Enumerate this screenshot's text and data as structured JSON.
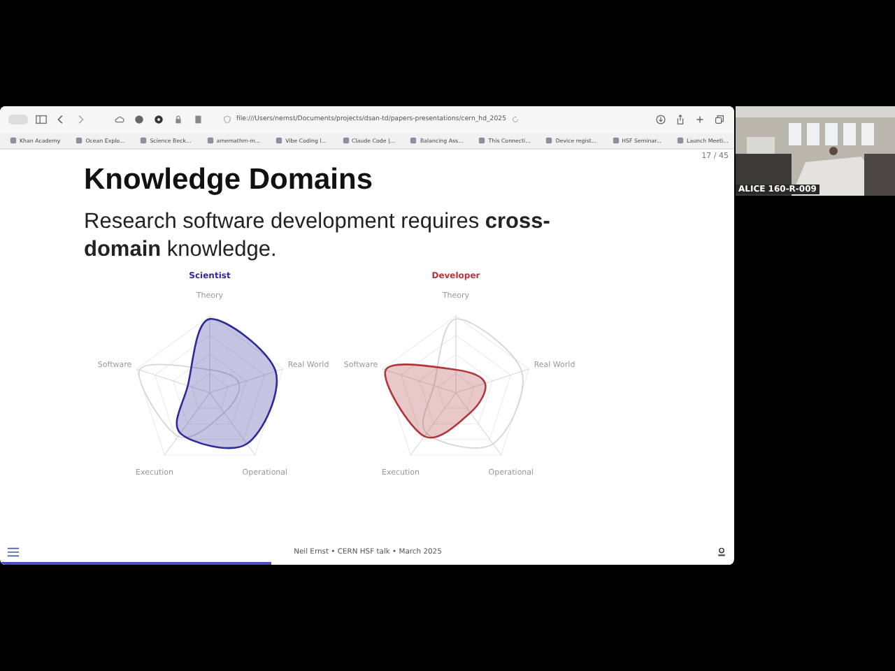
{
  "browser": {
    "url": "file:///Users/nernst/Documents/projects/dsan-td/papers-presentations/cern_hd_2025",
    "bookmarks": [
      {
        "label": "Khan Academy"
      },
      {
        "label": "Ocean Explo..."
      },
      {
        "label": "Science Beck..."
      },
      {
        "label": "amemathm-m..."
      },
      {
        "label": "Vibe Coding l..."
      },
      {
        "label": "Claude Code |..."
      },
      {
        "label": "Balancing Ass..."
      },
      {
        "label": "This Connecti..."
      },
      {
        "label": "Device regist..."
      },
      {
        "label": "HSF Seminar..."
      },
      {
        "label": "Launch Meeti..."
      }
    ]
  },
  "slide": {
    "counter": "17 / 45",
    "title": "Knowledge Domains",
    "text": "Research software development requires **cross-domain** knowledge.",
    "charts": [
      {
        "title": "Scientist",
        "color": "#2f2a9a",
        "axes": [
          "Theory",
          "Software",
          "Real World",
          "Execution",
          "Operational"
        ]
      },
      {
        "title": "Developer",
        "color": "#b0383c",
        "axes": [
          "Theory",
          "Software",
          "Real World",
          "Execution",
          "Operational"
        ]
      }
    ],
    "footer": "Neil Ernst • CERN HSF talk • March 2025",
    "progress": {
      "level": 0.37
    }
  },
  "video": {
    "label": "ALICE 160-R-009"
  }
}
